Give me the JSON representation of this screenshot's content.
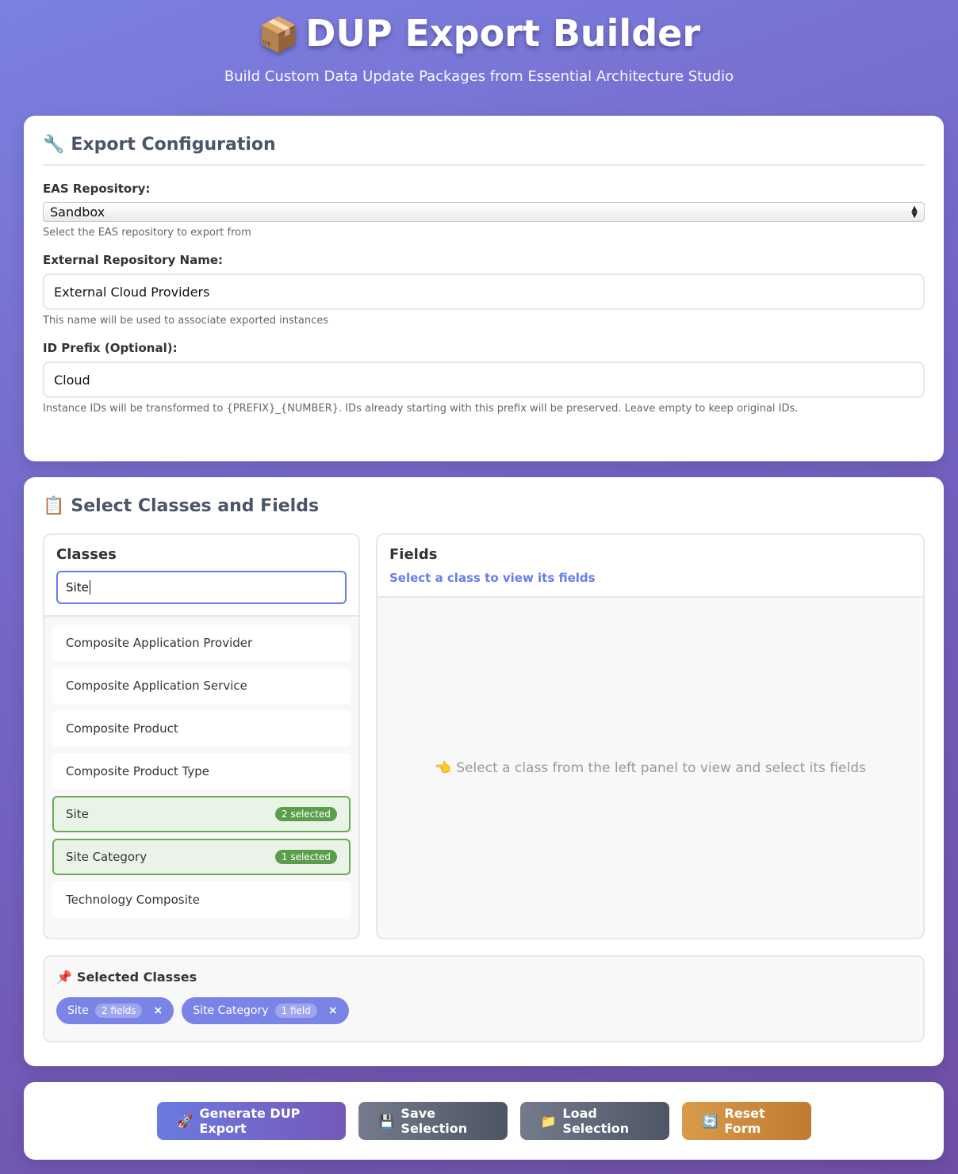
{
  "header": {
    "icon": "📦",
    "title": "DUP Export Builder",
    "subtitle": "Build Custom Data Update Packages from Essential Architecture Studio"
  },
  "config": {
    "icon": "🔧",
    "title": "Export Configuration",
    "repo_label": "EAS Repository:",
    "repo_value": "Sandbox",
    "repo_hint": "Select the EAS repository to export from",
    "ext_label": "External Repository Name:",
    "ext_value": "External Cloud Providers",
    "ext_hint": "This name will be used to associate exported instances",
    "prefix_label": "ID Prefix (Optional):",
    "prefix_value": "Cloud",
    "prefix_hint": "Instance IDs will be transformed to {PREFIX}_{NUMBER}. IDs already starting with this prefix will be preserved. Leave empty to keep original IDs."
  },
  "classes_section": {
    "icon": "📋",
    "title": "Select Classes and Fields",
    "classes_heading": "Classes",
    "search_value": "Site",
    "items": [
      {
        "label": "Composite Application Provider",
        "badge": ""
      },
      {
        "label": "Composite Application Service",
        "badge": ""
      },
      {
        "label": "Composite Product",
        "badge": ""
      },
      {
        "label": "Composite Product Type",
        "badge": ""
      },
      {
        "label": "Site",
        "badge": "2 selected"
      },
      {
        "label": "Site Category",
        "badge": "1 selected"
      },
      {
        "label": "Technology Composite",
        "badge": ""
      }
    ],
    "fields_heading": "Fields",
    "fields_sub": "Select a class to view its fields",
    "fields_empty_icon": "👈",
    "fields_empty": "Select a class from the left panel to view and select its fields"
  },
  "selected": {
    "icon": "📌",
    "title": "Selected Classes",
    "chips": [
      {
        "label": "Site",
        "count": "2 fields",
        "remove": "×"
      },
      {
        "label": "Site Category",
        "count": "1 field",
        "remove": "×"
      }
    ]
  },
  "actions": {
    "generate": {
      "icon": "🚀",
      "label": "Generate DUP Export"
    },
    "save": {
      "icon": "💾",
      "label": "Save Selection"
    },
    "load": {
      "icon": "📁",
      "label": "Load Selection"
    },
    "reset": {
      "icon": "🔄",
      "label": "Reset Form"
    }
  }
}
